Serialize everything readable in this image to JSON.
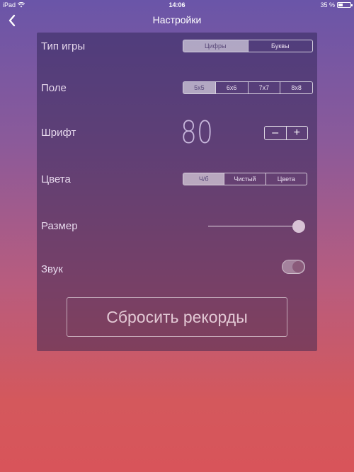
{
  "status_bar": {
    "device": "iPad",
    "time": "14:06",
    "battery": "35 %",
    "battery_level": 0.35,
    "icons": [
      "wifi-icon",
      "battery-icon"
    ]
  },
  "nav": {
    "title": "Настройки",
    "back_icon": "chevron-left-icon"
  },
  "settings": {
    "game_type": {
      "label": "Тип игры",
      "options": [
        "Цифры",
        "Буквы"
      ],
      "selected": 0
    },
    "field": {
      "label": "Поле",
      "options": [
        "5x5",
        "6x6",
        "7x7",
        "8x8"
      ],
      "selected": 0
    },
    "font": {
      "label": "Шрифт",
      "value": "80",
      "minus": "–",
      "plus": "+"
    },
    "colors": {
      "label": "Цвета",
      "options": [
        "Ч/б",
        "Чистый",
        "Цвета"
      ],
      "selected": 0
    },
    "size": {
      "label": "Размер",
      "value": 1.0
    },
    "sound": {
      "label": "Звук",
      "on": true
    },
    "reset_button": "Сбросить рекорды"
  }
}
